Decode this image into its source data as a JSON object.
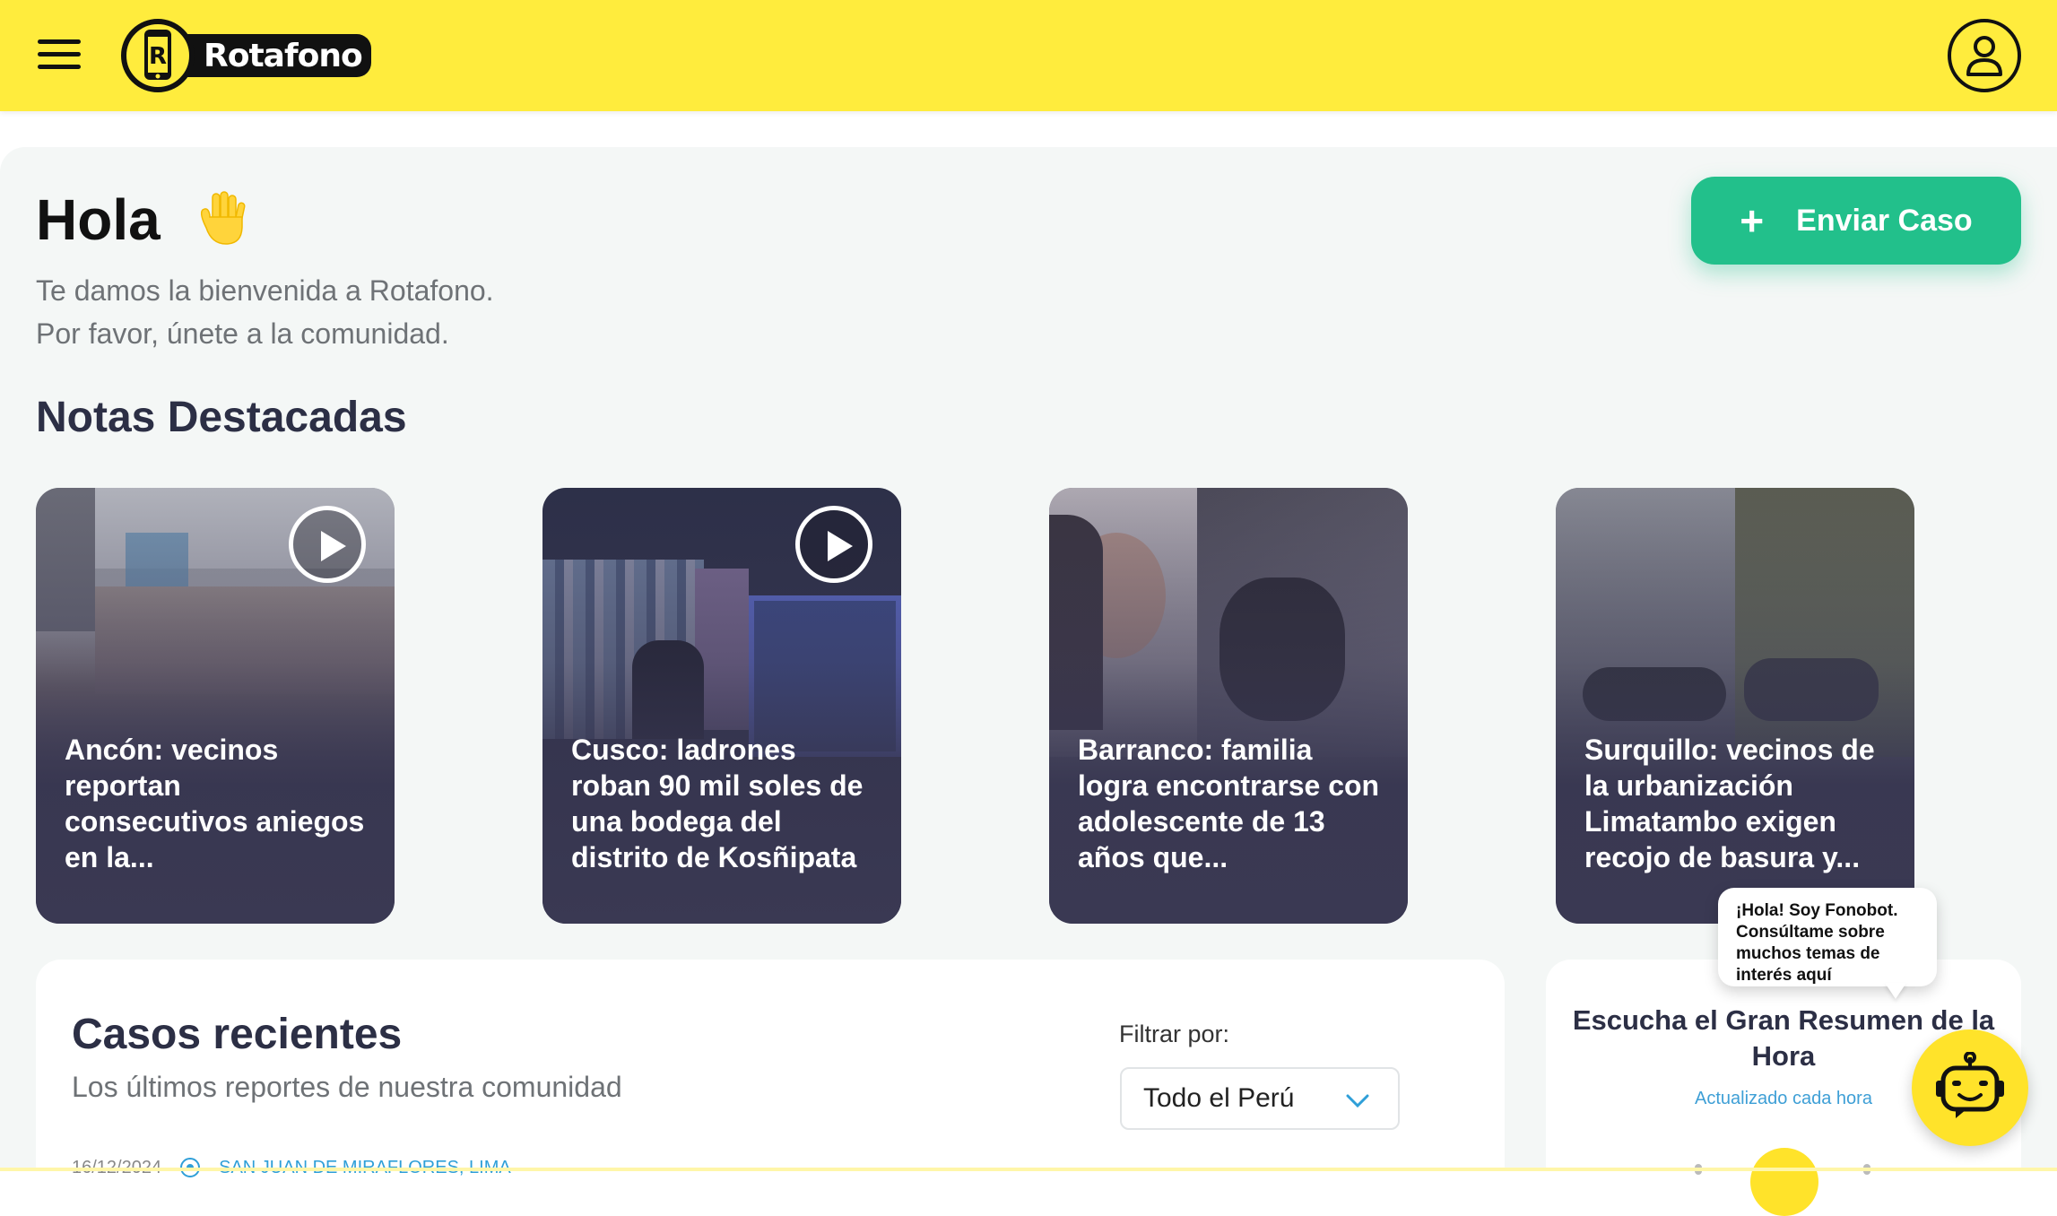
{
  "header": {
    "brand": "Rotafono",
    "menu_icon": "hamburger-menu-icon",
    "user_icon": "user-icon",
    "bg_color": "#ffec3d"
  },
  "hero": {
    "greeting": "Hola",
    "welcome_line1": "Te damos la bienvenida a Rotafono.",
    "welcome_line2": "Por favor, únete a la comunidad.",
    "send_button": "Enviar Caso",
    "send_button_color": "#22c08b"
  },
  "featured": {
    "title": "Notas Destacadas",
    "cards": [
      {
        "title": "Ancón: vecinos reportan consecutivos aniegos en la...",
        "video": true
      },
      {
        "title": "Cusco: ladrones roban 90 mil soles de una bodega del distrito de Kosñipata",
        "video": true
      },
      {
        "title": "Barranco: familia logra encontrarse con adolescente de 13 años que...",
        "video": false
      },
      {
        "title": "Surquillo: vecinos de la urbanización Limatambo exigen recojo de basura y...",
        "video": false
      }
    ]
  },
  "recent": {
    "title": "Casos recientes",
    "subtitle": "Los últimos reportes de nuestra comunidad",
    "filter_label": "Filtrar por:",
    "filter_value": "Todo el Perú",
    "first_case_date": "16/12/2024",
    "first_case_location": "SAN JUAN DE MIRAFLORES, LIMA"
  },
  "audio": {
    "title": "Escucha el Gran Resumen de la Hora",
    "subtitle": "Actualizado cada hora"
  },
  "chatbot": {
    "bubble": "¡Hola! Soy Fonobot. Consúltame sobre muchos temas de interés aquí",
    "icon": "robot-icon"
  }
}
